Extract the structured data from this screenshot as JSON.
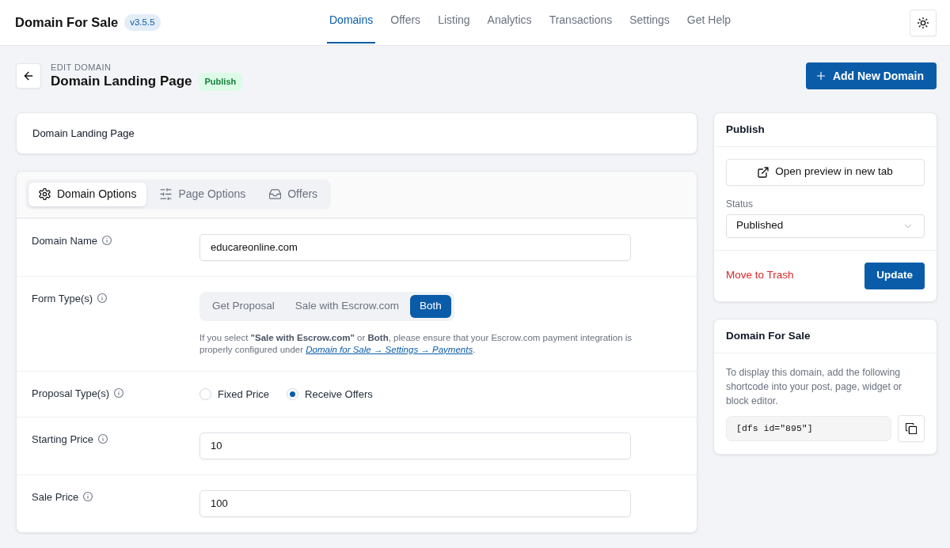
{
  "header": {
    "brand": "Domain For Sale",
    "version": "v3.5.5",
    "nav": [
      {
        "label": "Domains",
        "selected": true
      },
      {
        "label": "Offers",
        "selected": false
      },
      {
        "label": "Listing",
        "selected": false
      },
      {
        "label": "Analytics",
        "selected": false
      },
      {
        "label": "Transactions",
        "selected": false
      },
      {
        "label": "Settings",
        "selected": false
      },
      {
        "label": "Get Help",
        "selected": false
      }
    ]
  },
  "page_header": {
    "eyebrow": "EDIT DOMAIN",
    "title": "Domain Landing Page",
    "status_badge": "Publish",
    "add_button": "Add New Domain"
  },
  "title_card": {
    "text": "Domain Landing Page"
  },
  "options_tabs": [
    {
      "label": "Domain Options",
      "selected": true
    },
    {
      "label": "Page Options",
      "selected": false
    },
    {
      "label": "Offers",
      "selected": false
    }
  ],
  "fields": [
    {
      "kind": "text",
      "label": "Domain Name",
      "value": "educareonline.com"
    },
    {
      "kind": "segmented",
      "label": "Form Type(s)",
      "options": [
        {
          "label": "Get Proposal",
          "selected": false
        },
        {
          "label": "Sale with Escrow.com",
          "selected": false
        },
        {
          "label": "Both",
          "selected": true
        }
      ],
      "help": {
        "before": "If you select **\"Sale with Escrow.com\"** or **Both**, please ensure that your Escrow.com payment integration is properly configured under",
        "link": "Domain for Sale → Settings → Payments",
        "after": "."
      }
    },
    {
      "kind": "radio",
      "label": "Proposal Type(s)",
      "options": [
        {
          "label": "Fixed Price",
          "selected": false
        },
        {
          "label": "Receive Offers",
          "selected": true
        }
      ]
    },
    {
      "kind": "text",
      "label": "Starting Price",
      "value": "10"
    },
    {
      "kind": "text",
      "label": "Sale Price",
      "value": "100"
    }
  ],
  "publish_panel": {
    "title": "Publish",
    "preview_button": "Open preview in new tab",
    "status_label": "Status",
    "status_value": "Published",
    "trash_link": "Move to Trash",
    "update_button": "Update"
  },
  "shortcode_panel": {
    "title": "Domain For Sale",
    "description": "To display this domain, add the following shortcode into your post, page, widget or block editor.",
    "shortcode": "[dfs id=\"895\"]"
  }
}
